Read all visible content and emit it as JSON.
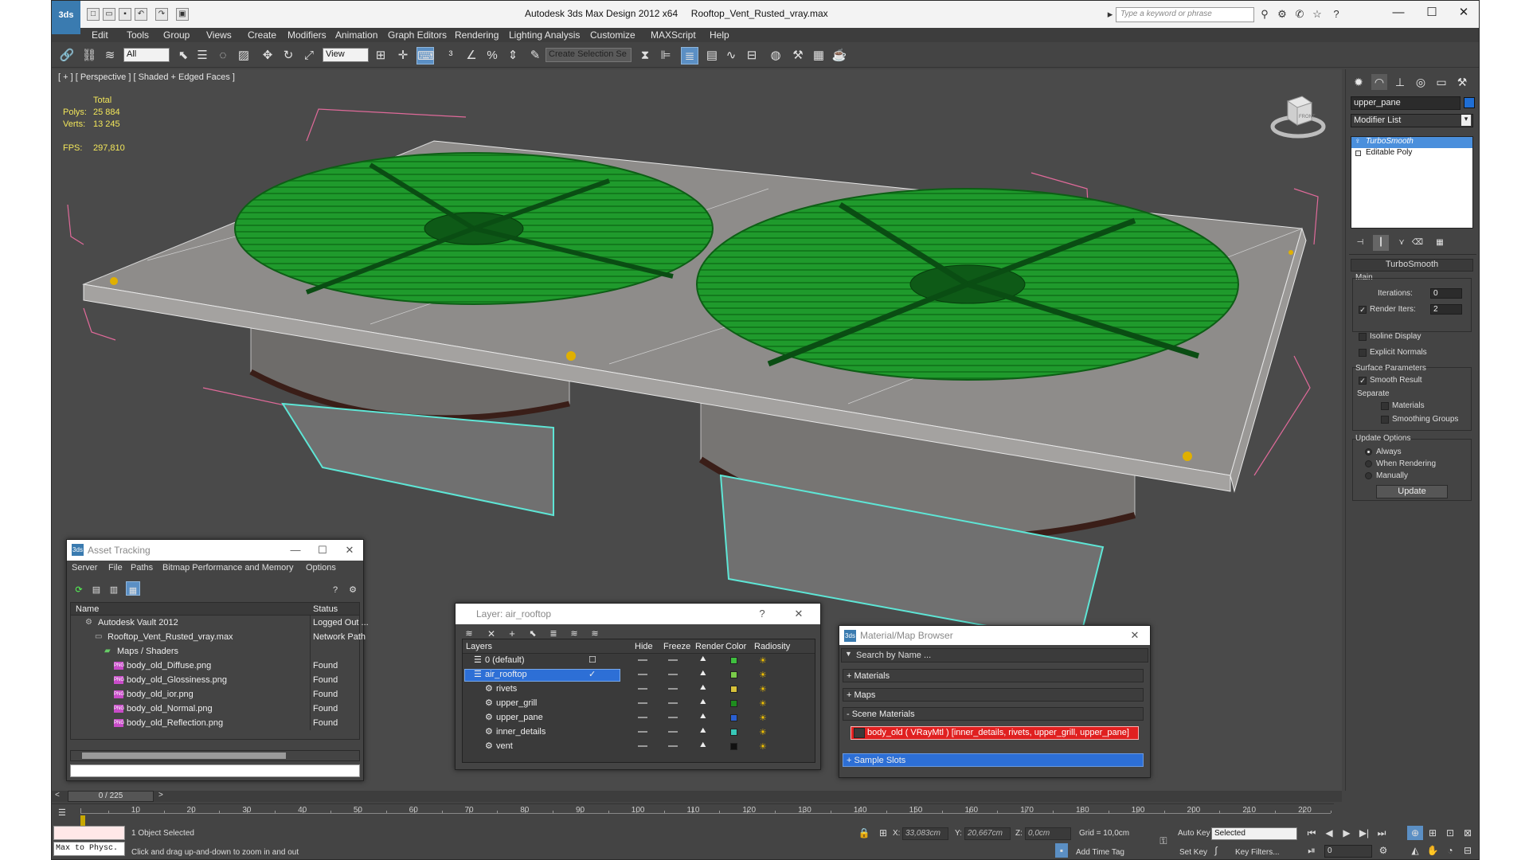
{
  "app": {
    "logo": "3ds",
    "title": "Autodesk 3ds Max Design 2012 x64",
    "filename": "Rooftop_Vent_Rusted_vray.max",
    "search_placeholder": "Type a keyword or phrase"
  },
  "menu": [
    "Edit",
    "Tools",
    "Group",
    "Views",
    "Create",
    "Modifiers",
    "Animation",
    "Graph Editors",
    "Rendering",
    "Lighting Analysis",
    "Customize",
    "MAXScript",
    "Help"
  ],
  "toolbar": {
    "filter_select": "All",
    "refcoord_select": "View",
    "selection_set_placeholder": "Create Selection Se"
  },
  "viewport": {
    "label": "[ + ] [ Perspective ] [ Shaded + Edged Faces ]",
    "stats": {
      "total_label": "Total",
      "polys_label": "Polys:",
      "polys_value": "25 884",
      "verts_label": "Verts:",
      "verts_value": "13 245",
      "fps_label": "FPS:",
      "fps_value": "297,810"
    },
    "viewcube_label": "FRONT",
    "colors": {
      "background": "#4a4a4a",
      "grill_green": "#1f9a2c",
      "body_gray": "#8a8886",
      "bbox_pink": "#e06a9a",
      "base_cyan": "#5ee6d6"
    }
  },
  "command_panel": {
    "object_name": "upper_pane",
    "object_color": "#1f6ed4",
    "modifier_list": "Modifier List",
    "stack": [
      "TurboSmooth",
      "Editable Poly"
    ],
    "rollout_title": "TurboSmooth",
    "main_group": "Main",
    "iterations_label": "Iterations:",
    "iterations_value": "0",
    "render_iters_label": "Render Iters:",
    "render_iters_value": "2",
    "isoline_label": "Isoline Display",
    "explicit_normals_label": "Explicit Normals",
    "surface_group": "Surface Parameters",
    "smooth_result_label": "Smooth Result",
    "separate_label": "Separate",
    "materials_label": "Materials",
    "smoothing_groups_label": "Smoothing Groups",
    "update_group": "Update Options",
    "always_label": "Always",
    "when_rendering_label": "When Rendering",
    "manually_label": "Manually",
    "update_button": "Update"
  },
  "asset_tracking": {
    "title": "Asset Tracking",
    "menu": [
      "Server",
      "File",
      "Paths",
      "Bitmap Performance and Memory",
      "Options"
    ],
    "col_name": "Name",
    "col_status": "Status",
    "rows": [
      {
        "name": "Autodesk Vault 2012",
        "status": "Logged Out ...",
        "indent": 0,
        "kind": "vault"
      },
      {
        "name": "Rooftop_Vent_Rusted_vray.max",
        "status": "Network Path",
        "indent": 1,
        "kind": "file"
      },
      {
        "name": "Maps / Shaders",
        "status": "",
        "indent": 2,
        "kind": "folder"
      },
      {
        "name": "body_old_Diffuse.png",
        "status": "Found",
        "indent": 3,
        "kind": "png"
      },
      {
        "name": "body_old_Glossiness.png",
        "status": "Found",
        "indent": 3,
        "kind": "png"
      },
      {
        "name": "body_old_ior.png",
        "status": "Found",
        "indent": 3,
        "kind": "png"
      },
      {
        "name": "body_old_Normal.png",
        "status": "Found",
        "indent": 3,
        "kind": "png"
      },
      {
        "name": "body_old_Reflection.png",
        "status": "Found",
        "indent": 3,
        "kind": "png"
      }
    ]
  },
  "layer_window": {
    "title": "Layer: air_rooftop",
    "help": "?",
    "columns": [
      "Layers",
      "Hide",
      "Freeze",
      "Render",
      "Color",
      "Radiosity"
    ],
    "rows": [
      {
        "name": "0 (default)",
        "color": "#3fbf3f",
        "level": 0
      },
      {
        "name": "air_rooftop",
        "color": "#7acb4a",
        "level": 0,
        "selected": true
      },
      {
        "name": "rivets",
        "color": "#d8c23a",
        "level": 1
      },
      {
        "name": "upper_grill",
        "color": "#1e8c1e",
        "level": 1
      },
      {
        "name": "upper_pane",
        "color": "#2a5fd0",
        "level": 1
      },
      {
        "name": "inner_details",
        "color": "#38c8b8",
        "level": 1
      },
      {
        "name": "vent",
        "color": "#111111",
        "level": 1
      }
    ]
  },
  "material_browser": {
    "title": "Material/Map Browser",
    "search_placeholder": "Search by Name ...",
    "materials": "+ Materials",
    "maps": "+ Maps",
    "scene_materials": "- Scene Materials",
    "scene_item": "body_old  ( VRayMtl )  [inner_details, rivets, upper_grill, upper_pane]",
    "sample_slots": "+ Sample Slots"
  },
  "timeline": {
    "frame_display": "0 / 225",
    "ticks": [
      "10",
      "20",
      "30",
      "40",
      "50",
      "60",
      "70",
      "80",
      "90",
      "100",
      "110",
      "120",
      "130",
      "140",
      "150",
      "160",
      "170",
      "180",
      "190",
      "200",
      "210",
      "220"
    ]
  },
  "status": {
    "maxscript_listener": "Max to Physc.",
    "selection_info": "1 Object Selected",
    "prompt": "Click and drag up-and-down to zoom in and out",
    "x_label": "X:",
    "x_value": "33,083cm",
    "y_label": "Y:",
    "y_value": "20,667cm",
    "z_label": "Z:",
    "z_value": "0,0cm",
    "grid": "Grid = 10,0cm",
    "add_time_tag": "Add Time Tag",
    "auto_key": "Auto Key",
    "set_key": "Set Key",
    "key_mode": "Selected",
    "key_filters": "Key Filters...",
    "frame": "0"
  }
}
